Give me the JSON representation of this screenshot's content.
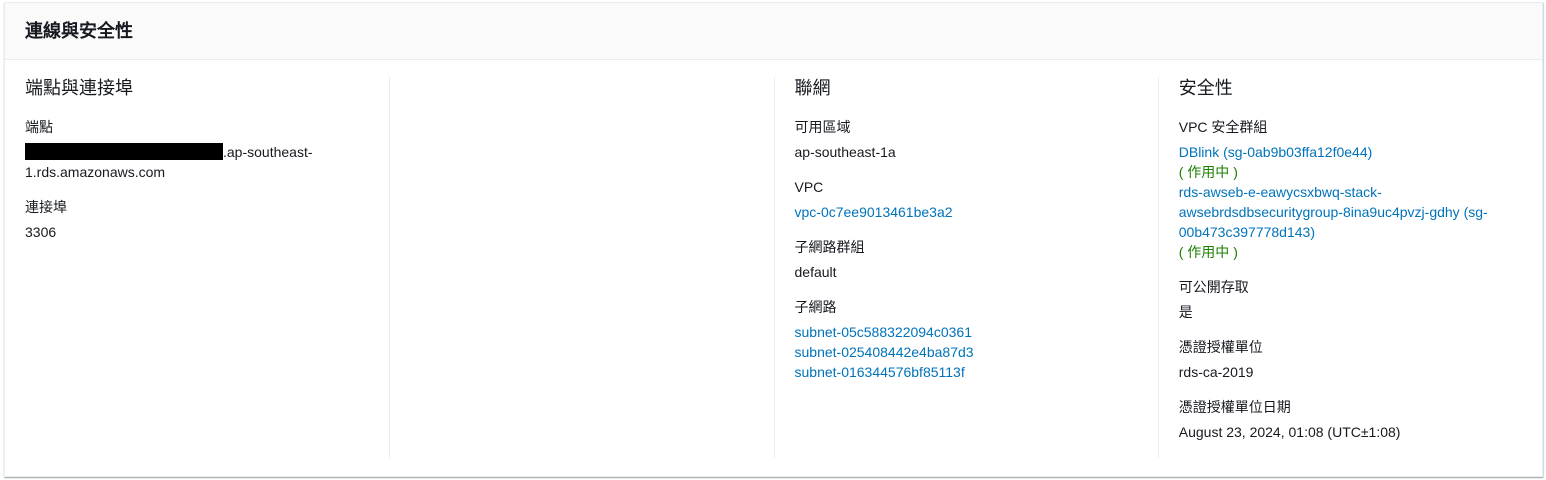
{
  "header": {
    "title": "連線與安全性"
  },
  "endpoint_section": {
    "title": "端點與連接埠",
    "endpoint_label": "端點",
    "endpoint_suffix_1": ".ap-southeast-",
    "endpoint_suffix_2": "1.rds.amazonaws.com",
    "port_label": "連接埠",
    "port_value": "3306"
  },
  "network_section": {
    "title": "聯網",
    "az_label": "可用區域",
    "az_value": "ap-southeast-1a",
    "vpc_label": "VPC",
    "vpc_value": "vpc-0c7ee9013461be3a2",
    "subnet_group_label": "子網路群組",
    "subnet_group_value": "default",
    "subnets_label": "子網路",
    "subnets": [
      "subnet-05c588322094c0361",
      "subnet-025408442e4ba87d3",
      "subnet-016344576bf85113f"
    ]
  },
  "security_section": {
    "title": "安全性",
    "sg_label": "VPC 安全群組",
    "security_groups": [
      {
        "name": "DBlink (sg-0ab9b03ffa12f0e44)",
        "status": "( 作用中 )"
      },
      {
        "name": "rds-awseb-e-eawycsxbwq-stack-awsebrdsdbsecuritygroup-8ina9uc4pvzj-gdhy (sg-00b473c397778d143)",
        "status": "( 作用中 )"
      }
    ],
    "public_label": "可公開存取",
    "public_value": "是",
    "ca_label": "憑證授權單位",
    "ca_value": "rds-ca-2019",
    "ca_date_label": "憑證授權單位日期",
    "ca_date_value": "August 23, 2024, 01:08 (UTC±1:08)"
  },
  "colors": {
    "link": "#0073bb",
    "success": "#1d8102"
  }
}
